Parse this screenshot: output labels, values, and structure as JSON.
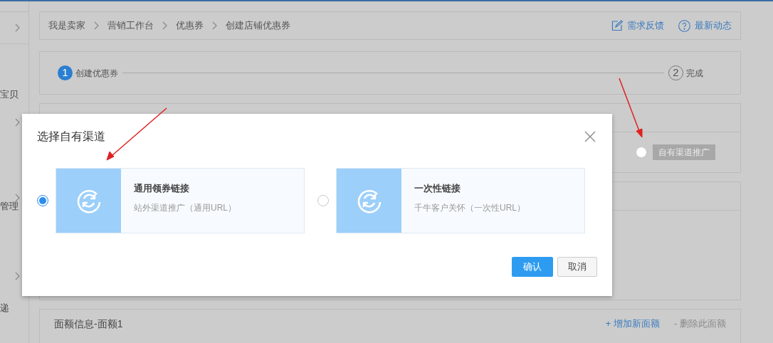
{
  "sidebar": {
    "labels": [
      "宝贝",
      "管理",
      "递"
    ]
  },
  "breadcrumb": [
    "我是卖家",
    "营销工作台",
    "优惠券",
    "创建店铺优惠券"
  ],
  "header_links": [
    {
      "kind": "feedback",
      "label": "需求反馈"
    },
    {
      "kind": "news",
      "label": "最新动态"
    }
  ],
  "steps": [
    {
      "number": "1",
      "label": "创建优惠券",
      "selected": true
    },
    {
      "number": "2",
      "label": "完成",
      "selected": false
    }
  ],
  "channel_option": {
    "label": "自有渠道推广",
    "checked": false,
    "disabled": true
  },
  "face_value": {
    "title": "面额信息-面额1",
    "actions": [
      {
        "label": "+ 增加新面额",
        "disabled": false
      },
      {
        "label": "- 删除此面额",
        "disabled": true
      }
    ]
  },
  "modal": {
    "title": "选择自有渠道",
    "options": [
      {
        "title": "通用领券链接",
        "subtitle": "站外渠道推广（通用URL）",
        "selected": true
      },
      {
        "title": "一次性链接",
        "subtitle": "千牛客户关怀（一次性URL）",
        "selected": false
      }
    ],
    "buttons": [
      {
        "kind": "primary",
        "label": "确认"
      },
      {
        "kind": "default",
        "label": "取消"
      }
    ]
  }
}
